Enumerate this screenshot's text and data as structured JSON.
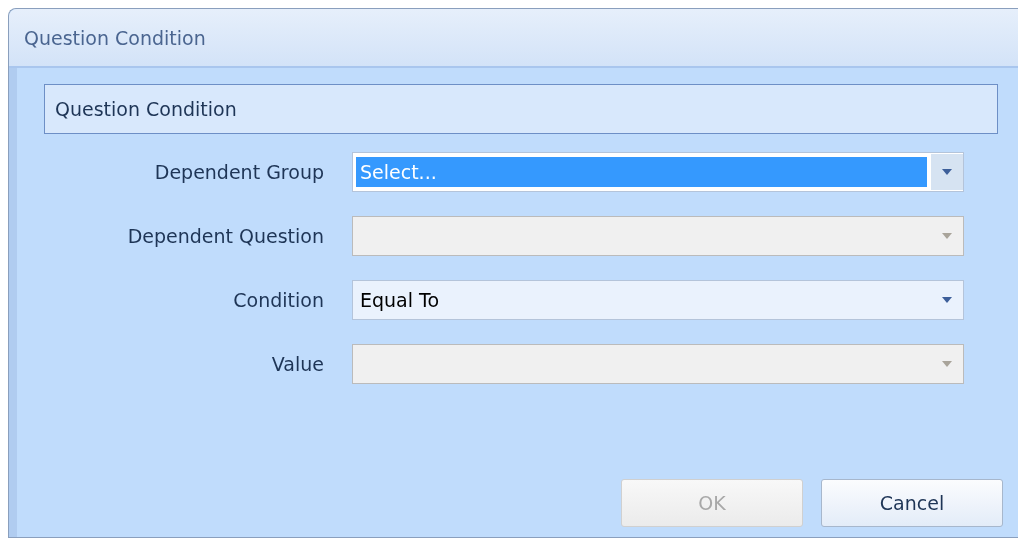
{
  "window": {
    "title": "Question Condition"
  },
  "group": {
    "title": "Question Condition"
  },
  "fields": [
    {
      "label": "Dependent Group",
      "value": "Select...",
      "selected": true,
      "disabled": false
    },
    {
      "label": "Dependent Question",
      "disabled": true,
      "selected": false
    },
    {
      "label": "Condition",
      "value": "Equal To",
      "disabled": false,
      "selected": false
    },
    {
      "label": "Value",
      "disabled": true,
      "selected": false
    }
  ],
  "buttons": [
    {
      "label": "OK",
      "disabled": true
    },
    {
      "label": "Cancel",
      "disabled": false
    }
  ]
}
